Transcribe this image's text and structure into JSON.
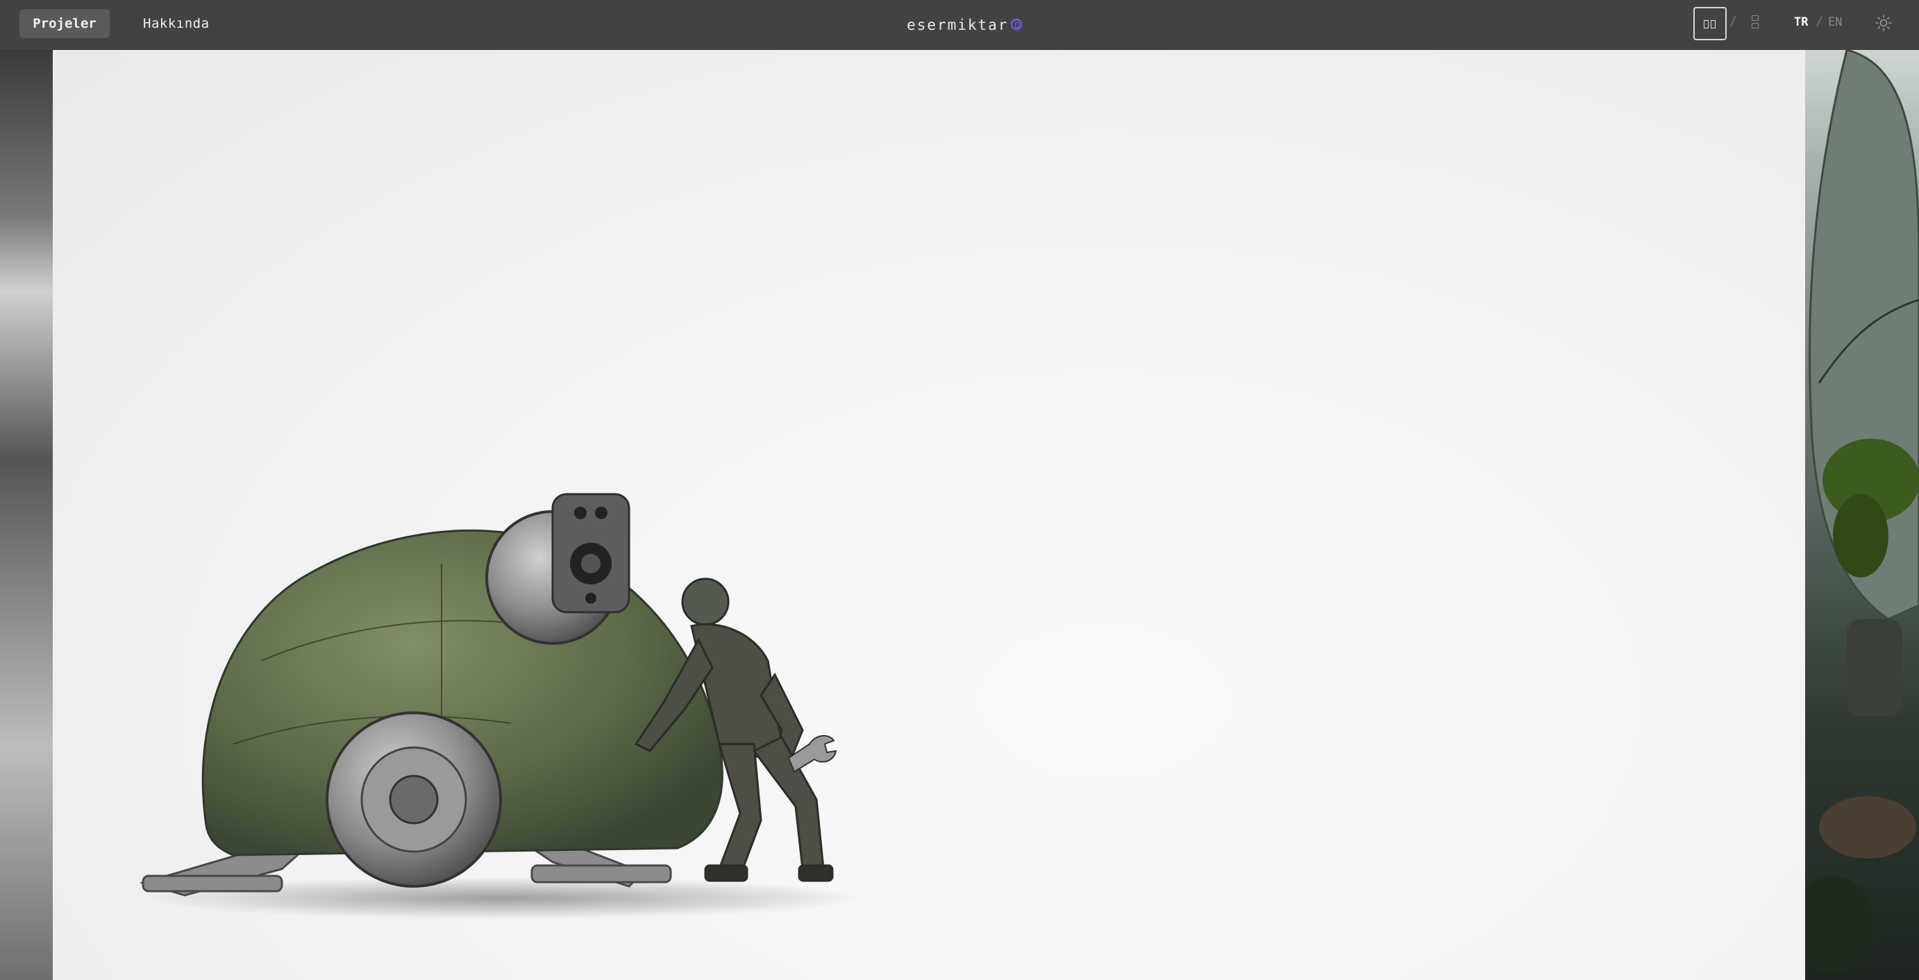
{
  "nav": {
    "projects_label": "Projeler",
    "about_label": "Hakkında"
  },
  "brand": {
    "name": "esermiktar",
    "accent_color": "#7c5cff"
  },
  "view": {
    "separator": "/",
    "grid_icon": "grid-view-icon",
    "list_icon": "list-view-icon"
  },
  "language": {
    "tr_label": "TR",
    "separator": "/",
    "en_label": "EN",
    "active": "TR"
  },
  "theme": {
    "icon": "sun-icon"
  },
  "gallery": {
    "current_image": "green-robot-with-mechanic",
    "previous_image": "misty-landscape",
    "next_image": "mossy-robot-closeup"
  }
}
